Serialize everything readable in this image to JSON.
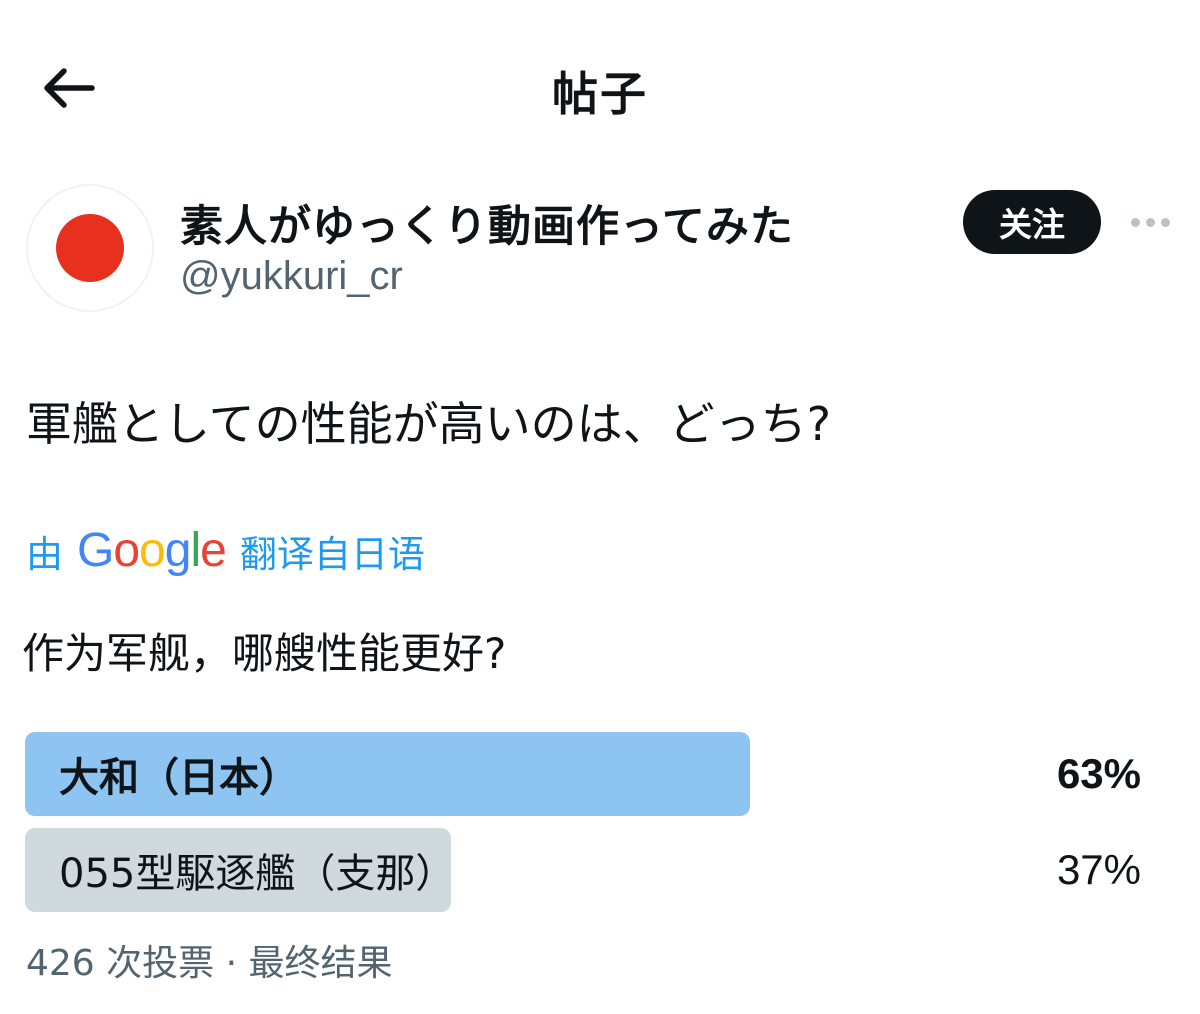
{
  "header": {
    "back_icon": "arrow-left-icon",
    "title": "帖子"
  },
  "author": {
    "avatar_icon": "rising-sun-flag-avatar",
    "avatar_color": "#e8301f",
    "display_name": "素人がゆっくり動画作ってみた",
    "handle": "@yukkuri_cr",
    "follow_label": "关注",
    "more_icon": "more-horizontal-icon"
  },
  "tweet": {
    "text": "軍艦としての性能が高いのは、どっち?"
  },
  "translation": {
    "by": "由",
    "provider": "Google",
    "from": "翻译自日语",
    "text": "作为军舰，哪艘性能更好?",
    "link_color": "#1d9bf0"
  },
  "poll": {
    "options": [
      {
        "label": "大和（日本）",
        "percent_text": "63%",
        "percent": 63,
        "color": "#8ec4f2",
        "winner": true
      },
      {
        "label": "055型駆逐艦（支那）",
        "percent_text": "37%",
        "percent": 37,
        "color": "#cfd9de",
        "winner": false
      }
    ],
    "footer": "426 次投票 · 最终结果"
  }
}
